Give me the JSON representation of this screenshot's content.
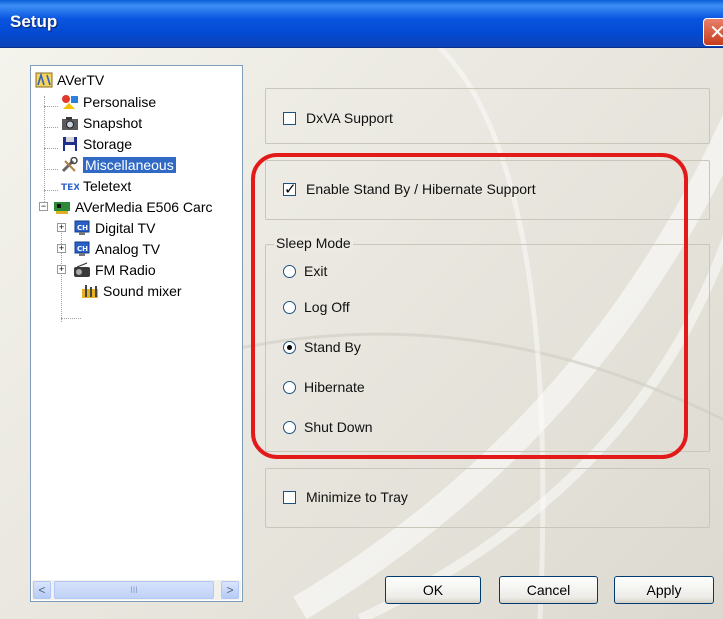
{
  "window": {
    "title": "Setup",
    "close_glyph": "✕"
  },
  "tree": {
    "items": [
      {
        "label": "AVerTV",
        "icon": "avertv-icon"
      },
      {
        "label": "Personalise",
        "icon": "personalise-icon"
      },
      {
        "label": "Snapshot",
        "icon": "camera-icon"
      },
      {
        "label": "Storage",
        "icon": "floppy-disk-icon"
      },
      {
        "label": "Miscellaneous",
        "icon": "tools-icon",
        "selected": true
      },
      {
        "label": "Teletext",
        "icon": "teletext-icon"
      },
      {
        "label": "AVerMedia E506 Carc",
        "icon": "tv-card-icon"
      },
      {
        "label": "Digital TV",
        "icon": "channel-icon"
      },
      {
        "label": "Analog TV",
        "icon": "channel-icon"
      },
      {
        "label": "FM Radio",
        "icon": "radio-icon"
      },
      {
        "label": "Sound mixer",
        "icon": "sound-mixer-icon"
      }
    ],
    "expander_minus": "−",
    "expander_plus": "+",
    "scroll": {
      "left_glyph": "<",
      "right_glyph": ">",
      "thumb_grip": "III"
    }
  },
  "options": {
    "dxva": {
      "label": "DxVA Support",
      "checked": false
    },
    "standby": {
      "label": "Enable Stand By / Hibernate Support",
      "checked": true
    },
    "sleep_mode": {
      "legend": "Sleep Mode",
      "options": [
        {
          "label": "Exit",
          "checked": false
        },
        {
          "label": "Log Off",
          "checked": false
        },
        {
          "label": "Stand By",
          "checked": true
        },
        {
          "label": "Hibernate",
          "checked": false
        },
        {
          "label": "Shut Down",
          "checked": false
        }
      ]
    },
    "minimize": {
      "label": "Minimize to Tray",
      "checked": false
    }
  },
  "buttons": {
    "ok": "OK",
    "cancel": "Cancel",
    "apply": "Apply"
  },
  "colors": {
    "title_bar": "#0a55e0",
    "highlight": "#e21a1a",
    "selection": "#316ac5"
  }
}
